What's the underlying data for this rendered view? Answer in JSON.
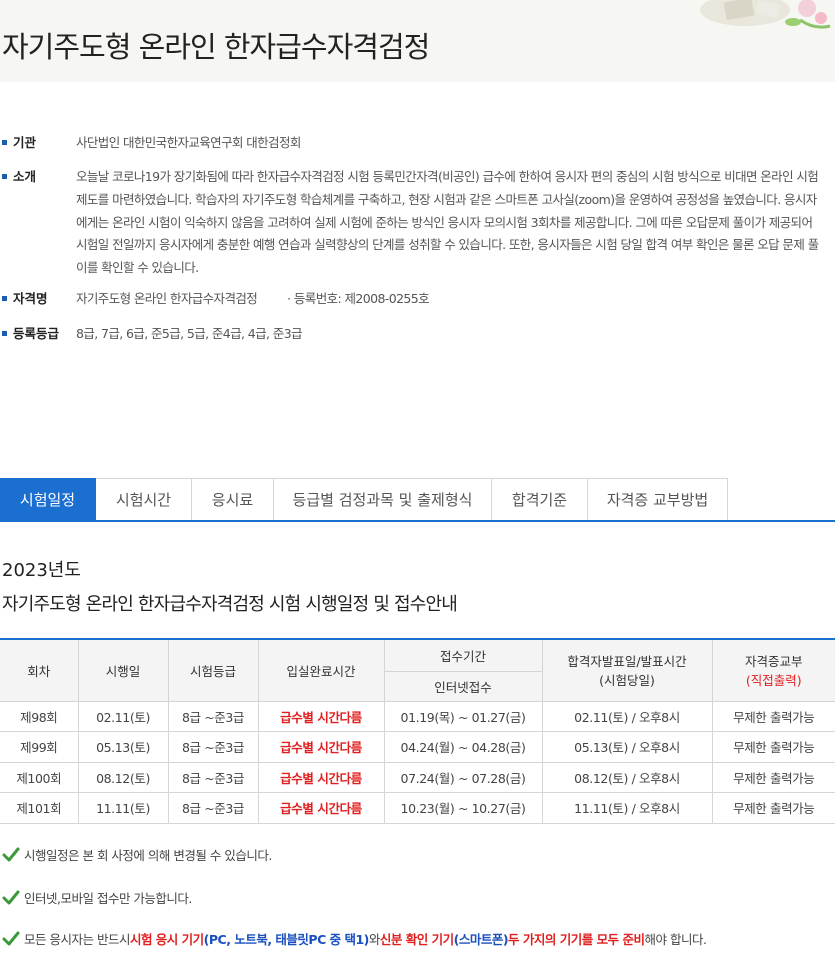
{
  "header": {
    "title": "자기주도형 온라인 한자급수자격검정"
  },
  "info": {
    "org_label": "기관",
    "org_value": "사단법인 대한민국한자교육연구회 대한검정회",
    "intro_label": "소개",
    "intro_value": "오늘날 코로나19가 장기화됨에 따라 한자급수자격검정 시험 등록민간자격(비공인) 급수에 한하여 응시자 편의 중심의 시험 방식으로 비대면 온라인 시험제도를 마련하였습니다. 학습자의 자기주도형 학습체계를 구축하고, 현장 시험과 같은 스마트폰 고사실(zoom)을 운영하여 공정성을 높였습니다. 응시자에게는 온라인 시험이 익숙하지 않음을 고려하여 실제 시험에 준하는 방식인 응시자 모의시험 3회차를 제공합니다. 그에 따른 오답문제 풀이가 제공되어 시험일 전일까지 응시자에게 충분한 예행 연습과 실력향상의 단계를 성취할 수 있습니다. 또한, 응시자들은 시험 당일 합격 여부 확인은 물론 오답 문제 풀이를 확인할 수 있습니다.",
    "name_label": "자격명",
    "name_value": "자기주도형 온라인 한자급수자격검정",
    "reg_value": "· 등록번호: 제2008-0255호",
    "grade_label": "등록등급",
    "grade_value": "8급, 7급, 6급, 준5급, 5급, 준4급, 4급, 준3급"
  },
  "tabs": [
    "시험일정",
    "시험시간",
    "응시료",
    "등급별 검정과목 및 출제형식",
    "합격기준",
    "자격증 교부방법"
  ],
  "section": {
    "year": "2023년도",
    "subtitle": "자기주도형 온라인 한자급수자격검정 시험 시행일정 및 접수안내"
  },
  "table": {
    "headers": {
      "round": "회차",
      "date": "시행일",
      "grade": "시험등급",
      "entry": "입실완료시간",
      "period": "접수기간",
      "period_sub": "인터넷접수",
      "result": "합격자발표일/발표시간",
      "result_sub": "(시험당일)",
      "cert": "자격증교부",
      "cert_sub": "(직접출력)"
    },
    "rows": [
      {
        "round": "제98회",
        "date": "02.11(토)",
        "grade": "8급 ~준3급",
        "entry": "급수별 시간다름",
        "period": "01.19(목) ~ 01.27(금)",
        "result": "02.11(토) / 오후8시",
        "cert": "무제한 출력가능"
      },
      {
        "round": "제99회",
        "date": "05.13(토)",
        "grade": "8급 ~준3급",
        "entry": "급수별 시간다름",
        "period": "04.24(월) ~ 04.28(금)",
        "result": "05.13(토) / 오후8시",
        "cert": "무제한 출력가능"
      },
      {
        "round": "제100회",
        "date": "08.12(토)",
        "grade": "8급 ~준3급",
        "entry": "급수별 시간다름",
        "period": "07.24(월) ~ 07.28(금)",
        "result": "08.12(토) / 오후8시",
        "cert": "무제한 출력가능"
      },
      {
        "round": "제101회",
        "date": "11.11(토)",
        "grade": "8급 ~준3급",
        "entry": "급수별 시간다름",
        "period": "10.23(월) ~ 10.27(금)",
        "result": "11.11(토) / 오후8시",
        "cert": "무제한 출력가능"
      }
    ]
  },
  "notes": {
    "n1": "시행일정은 본 회 사정에 의해 변경될 수 있습니다.",
    "n2": "인터넷,모바일 접수만 가능합니다.",
    "n3_a": "모든 응시자는 반드시 ",
    "n3_b": "시험 응시 기기",
    "n3_c": "(PC, 노트북, 태블릿PC 중 택1)",
    "n3_d": "와 ",
    "n3_e": "신분 확인 기기",
    "n3_f": "(스마트폰)",
    "n3_g": " 두 가지의 기기를 모두 준비",
    "n3_h": "해야 합니다."
  },
  "colors": {
    "accent": "#1a6fd1",
    "red": "#e02020",
    "check": "#3a9a3a"
  }
}
